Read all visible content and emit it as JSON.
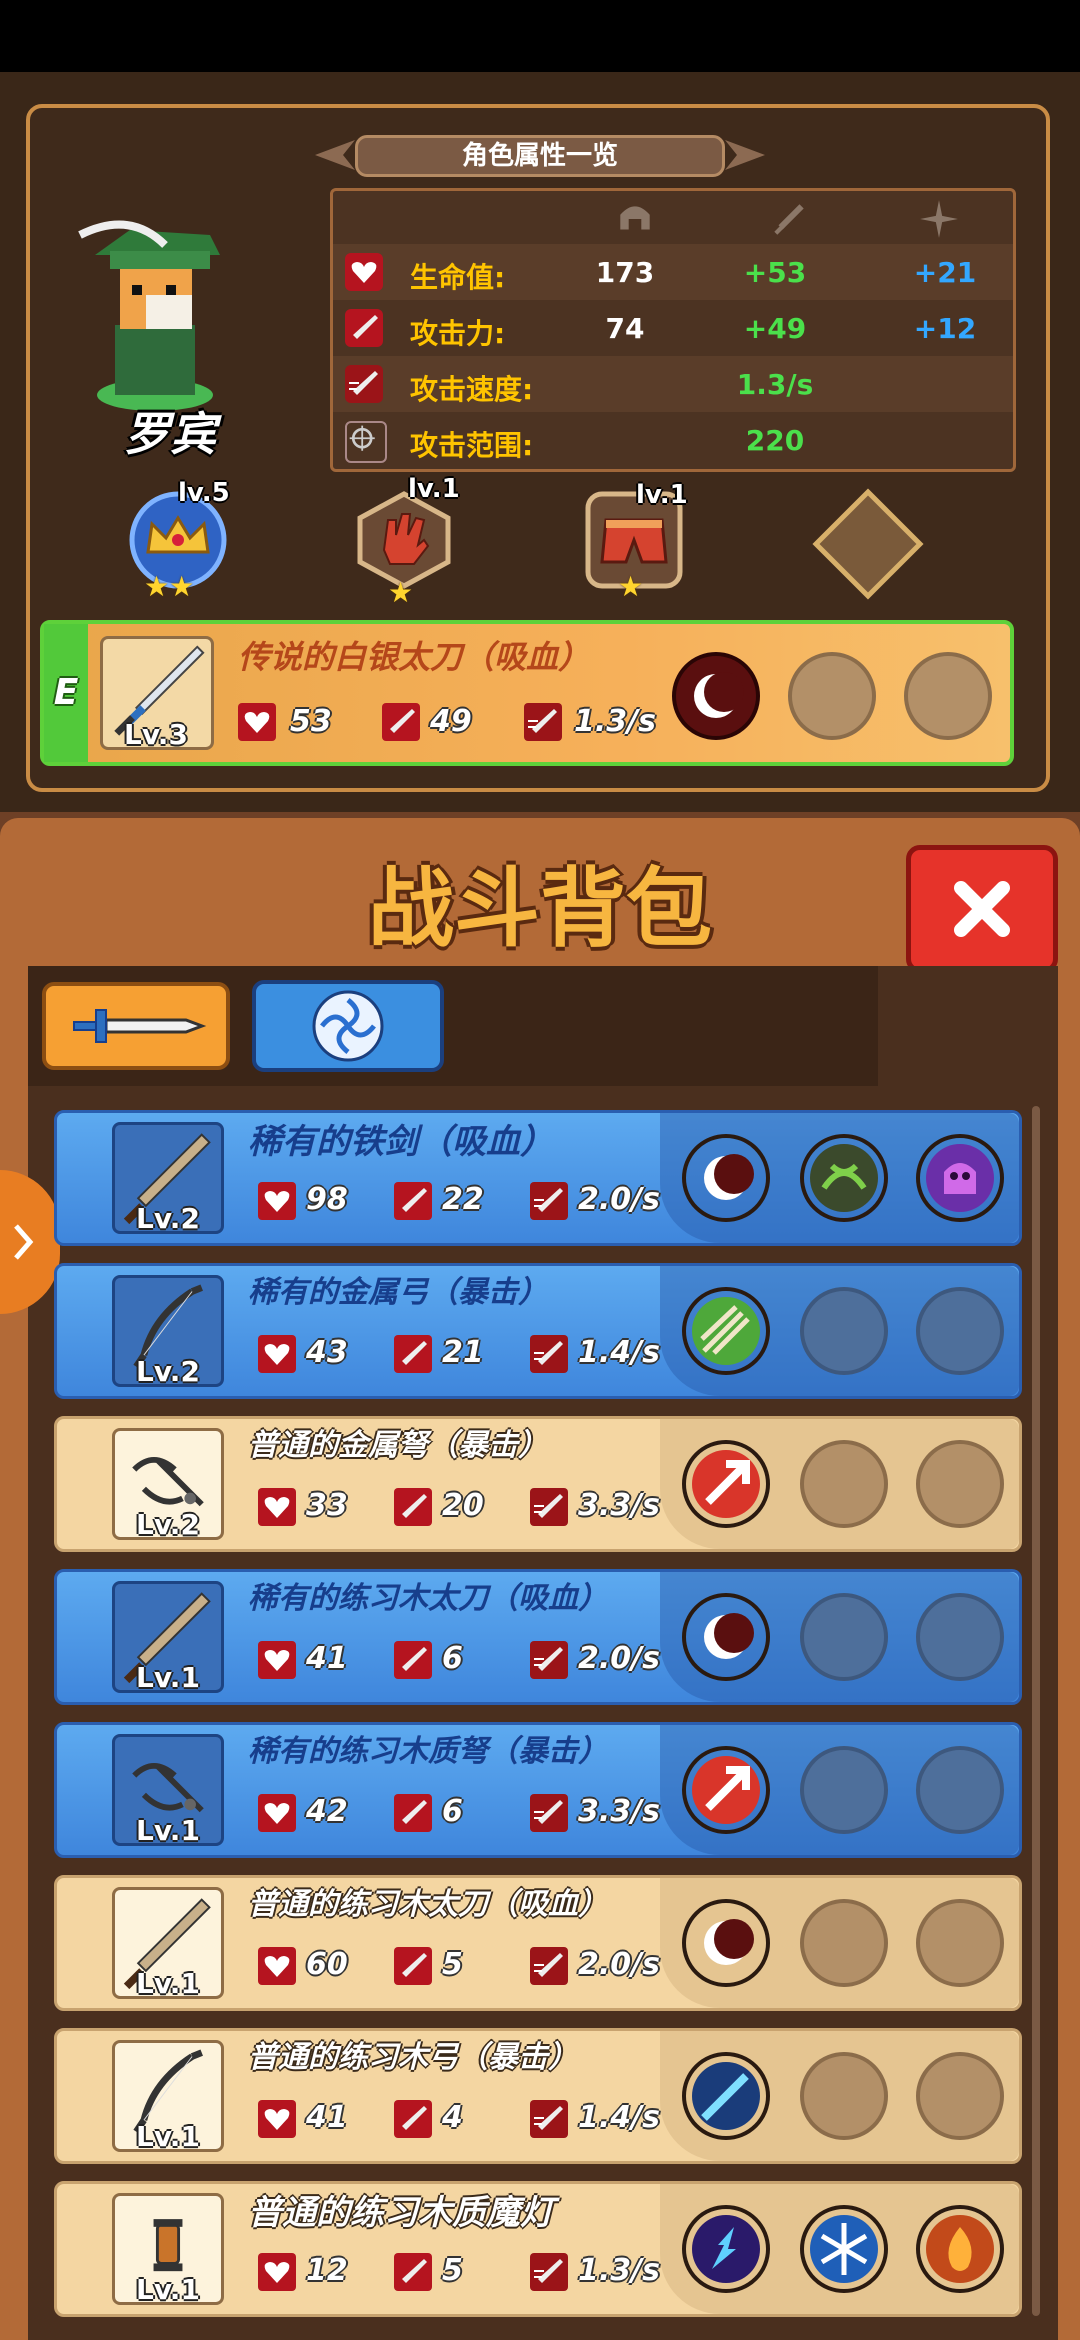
{
  "character_panel": {
    "title": "角色属性一览",
    "character_name": "罗宾",
    "stats": [
      {
        "label": "生命值:",
        "base": "173",
        "bonus_green": "+53",
        "bonus_blue": "+21"
      },
      {
        "label": "攻击力:",
        "base": "74",
        "bonus_green": "+49",
        "bonus_blue": "+12"
      },
      {
        "label": "攻击速度:",
        "base": "",
        "bonus_green": "1.3/s",
        "bonus_blue": ""
      },
      {
        "label": "攻击范围:",
        "base": "",
        "bonus_green": "220",
        "bonus_blue": ""
      }
    ],
    "equipment": [
      {
        "name": "crown",
        "level": "lv.5",
        "stars": "★★"
      },
      {
        "name": "glove",
        "level": "lv.1",
        "stars": "★"
      },
      {
        "name": "shorts",
        "level": "lv.1",
        "stars": "★"
      },
      {
        "name": "empty",
        "level": "",
        "stars": ""
      }
    ],
    "equipped_weapon": {
      "grade": "E",
      "name": "传说的白银太刀（吸血）",
      "level": "Lv.3",
      "hp": "53",
      "atk": "49",
      "speed": "1.3/s"
    }
  },
  "bag": {
    "title": "战斗背包",
    "close_symbol": "✕",
    "items": [
      {
        "rarity": "rare",
        "name": "稀有的铁剑（吸血）",
        "level": "Lv.2",
        "hp": "98",
        "atk": "22",
        "speed": "2.0/s",
        "skills": [
          "crescent",
          "thorn",
          "ghost"
        ]
      },
      {
        "rarity": "rare",
        "name": "稀有的金属弓（暴击）",
        "level": "Lv.2",
        "hp": "43",
        "atk": "21",
        "speed": "1.4/s",
        "skills": [
          "arrows",
          "empty",
          "empty"
        ]
      },
      {
        "rarity": "common",
        "name": "普通的金属弩（暴击）",
        "level": "Lv.2",
        "hp": "33",
        "atk": "20",
        "speed": "3.3/s",
        "skills": [
          "arrow-up",
          "empty",
          "empty"
        ]
      },
      {
        "rarity": "rare",
        "name": "稀有的练习木太刀（吸血）",
        "level": "Lv.1",
        "hp": "41",
        "atk": "6",
        "speed": "2.0/s",
        "skills": [
          "crescent",
          "empty",
          "empty"
        ]
      },
      {
        "rarity": "rare",
        "name": "稀有的练习木质弩（暴击）",
        "level": "Lv.1",
        "hp": "42",
        "atk": "6",
        "speed": "3.3/s",
        "skills": [
          "arrow-up",
          "empty",
          "empty"
        ]
      },
      {
        "rarity": "common",
        "name": "普通的练习木太刀（吸血）",
        "level": "Lv.1",
        "hp": "60",
        "atk": "5",
        "speed": "2.0/s",
        "skills": [
          "crescent",
          "empty",
          "empty"
        ]
      },
      {
        "rarity": "common",
        "name": "普通的练习木弓（暴击）",
        "level": "Lv.1",
        "hp": "41",
        "atk": "4",
        "speed": "1.4/s",
        "skills": [
          "ice-arrow",
          "empty",
          "empty"
        ]
      },
      {
        "rarity": "common",
        "name": "普通的练习木质魔灯",
        "level": "Lv.1",
        "hp": "12",
        "atk": "5",
        "speed": "1.3/s",
        "skills": [
          "lightning",
          "snowflake",
          "fire"
        ]
      }
    ]
  },
  "colors": {
    "gold_label": "#ffc400",
    "green_bonus": "#4be04b",
    "blue_bonus": "#33a7ff",
    "rare_bg": "#4a93e3",
    "common_bg": "#f4d6a2",
    "close_red": "#e6332a"
  }
}
